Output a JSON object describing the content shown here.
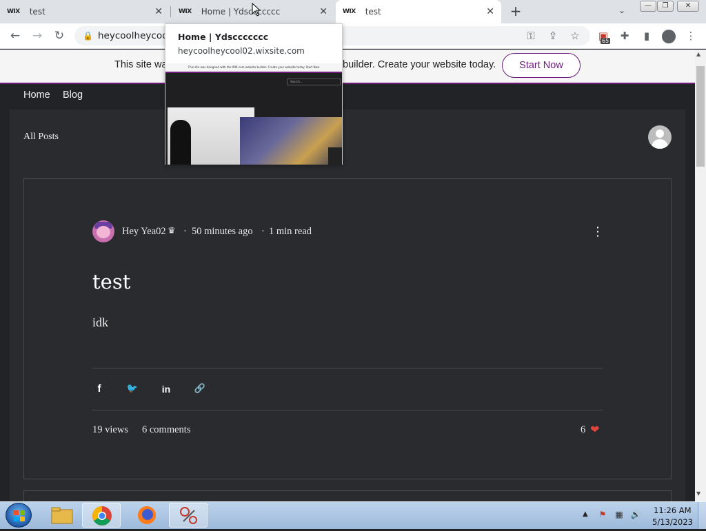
{
  "browser": {
    "tabs": [
      {
        "favicon": "WIX",
        "title": "test",
        "close": "✕"
      },
      {
        "favicon": "WIX",
        "title": "Home | Ydsccccccc",
        "close": "✕"
      },
      {
        "favicon": "WIX",
        "title": "test",
        "close": "✕"
      }
    ],
    "new_tab": "+",
    "tab_search": "⌄",
    "window_controls": {
      "minimize": "—",
      "maximize": "❐",
      "close": "✕"
    },
    "address": "heycoolheycool",
    "extension_badge": "65",
    "tooltip": {
      "title": "Home | Ydsccccccc",
      "url": "heycoolheycool02.wixsite.com",
      "preview_banner": "This site was designed with the WIX.com website builder. Create your website today.  Start Now",
      "preview_search": "Search..."
    }
  },
  "wix_banner": {
    "text_left": "This site wa",
    "text_right": "builder. Create your website today.",
    "button": "Start Now"
  },
  "site": {
    "nav": [
      "Home",
      "Blog"
    ],
    "section_title": "All Posts"
  },
  "post": {
    "author": "Hey Yea02",
    "separator": "·",
    "time": "50 minutes ago",
    "read_time": "1 min read",
    "more": "⋮",
    "title": "test",
    "body": "idk",
    "share": {
      "facebook": "f",
      "twitter": "🐦",
      "linkedin": "in",
      "link": "🔗"
    },
    "views": "19 views",
    "comments": "6 comments",
    "likes": "6",
    "heart": "❤"
  },
  "taskbar": {
    "time": "11:26 AM",
    "date": "5/13/2023"
  },
  "colors": {
    "accent_purple": "#6e1e78",
    "heart_red": "#e0443a",
    "page_bg": "#222326"
  }
}
